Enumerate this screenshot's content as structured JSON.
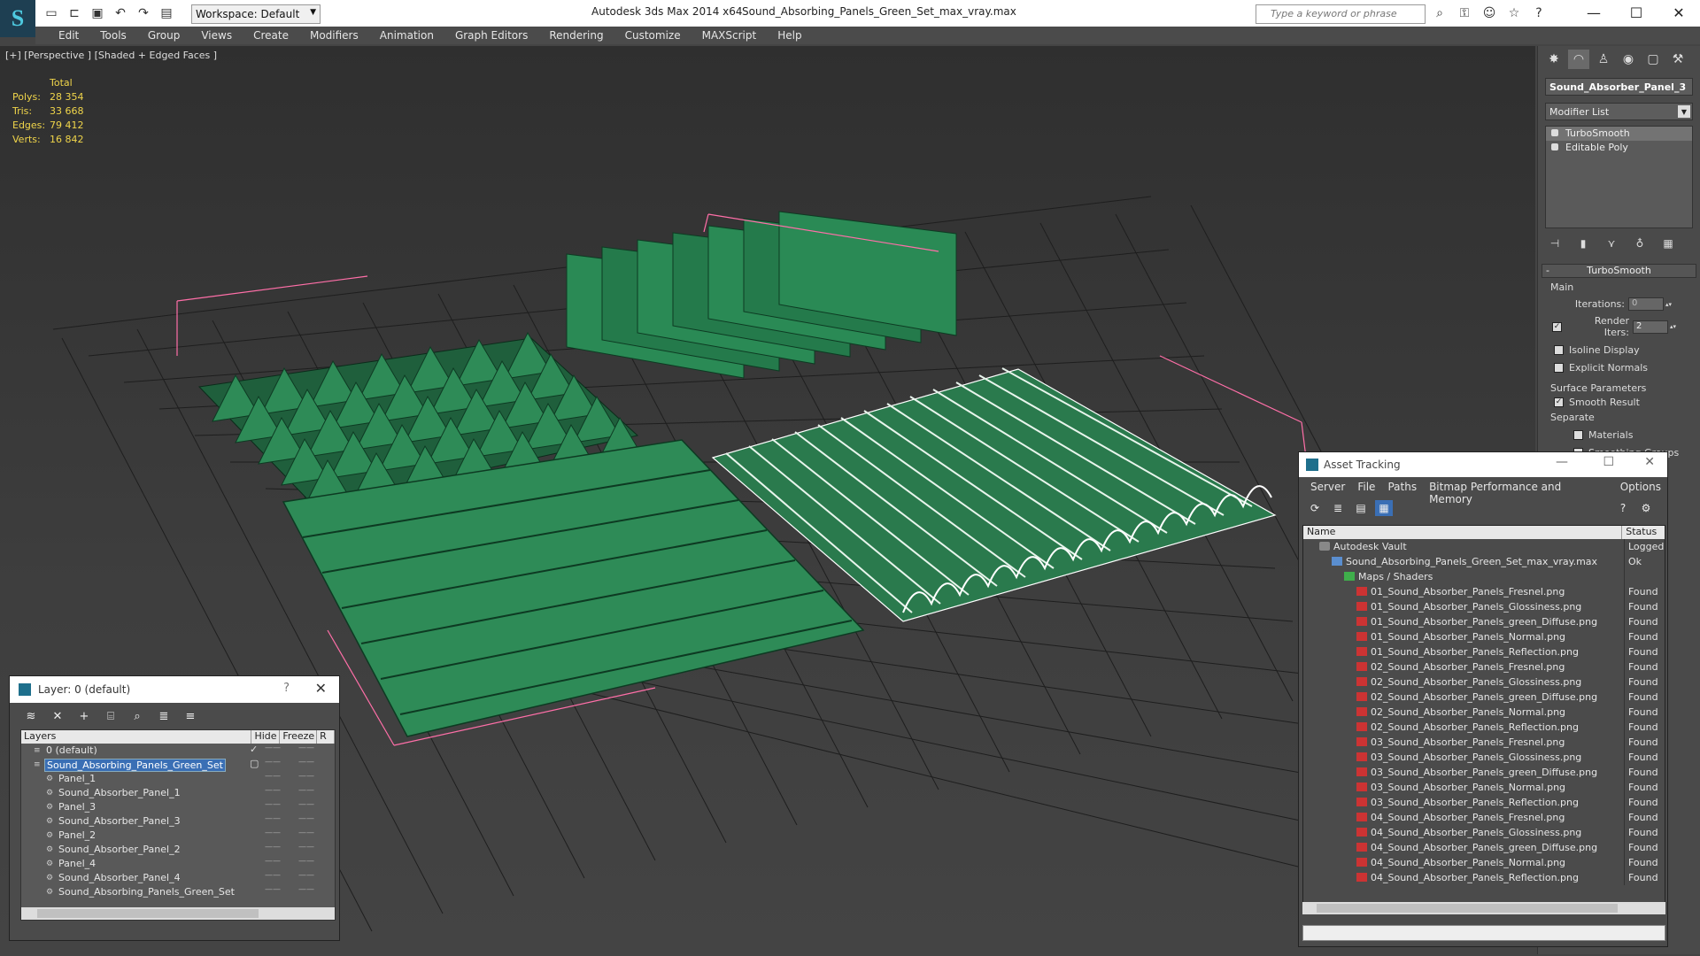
{
  "titlebar": {
    "app_title": "Autodesk 3ds Max  2014 x64",
    "file_title": "Sound_Absorbing_Panels_Green_Set_max_vray.max",
    "workspace_label": "Workspace: Default",
    "search_placeholder": "Type a keyword or phrase"
  },
  "menu": [
    "Edit",
    "Tools",
    "Group",
    "Views",
    "Create",
    "Modifiers",
    "Animation",
    "Graph Editors",
    "Rendering",
    "Customize",
    "MAXScript",
    "Help"
  ],
  "viewport": {
    "label": "[+] [Perspective ] [Shaded + Edged Faces ]",
    "stats": {
      "header": "Total",
      "rows": [
        {
          "k": "Polys:",
          "v": "28 354"
        },
        {
          "k": "Tris:",
          "v": "33 668"
        },
        {
          "k": "Edges:",
          "v": "79 412"
        },
        {
          "k": "Verts:",
          "v": "16 842"
        }
      ]
    }
  },
  "command_panel": {
    "object_name": "Sound_Absorber_Panel_3",
    "modifier_list": "Modifier List",
    "stack": [
      "TurboSmooth",
      "Editable Poly"
    ],
    "rollout_title": "TurboSmooth",
    "main_label": "Main",
    "iterations_label": "Iterations:",
    "iterations_value": "0",
    "render_iters_label": "Render Iters:",
    "render_iters_value": "2",
    "isoline_label": "Isoline Display",
    "explicit_label": "Explicit Normals",
    "surface_label": "Surface Parameters",
    "smooth_label": "Smooth Result",
    "separate_label": "Separate",
    "materials_label": "Materials",
    "smoothing_groups_label": "Smoothing Groups"
  },
  "layer_window": {
    "title": "Layer: 0 (default)",
    "columns": [
      "Layers",
      "Hide",
      "Freeze",
      "R"
    ],
    "rows": [
      {
        "name": "0 (default)",
        "indent": 0,
        "selected": false
      },
      {
        "name": "Sound_Absorbing_Panels_Green_Set",
        "indent": 0,
        "selected": true
      },
      {
        "name": "Panel_1",
        "indent": 1,
        "selected": false
      },
      {
        "name": "Sound_Absorber_Panel_1",
        "indent": 1,
        "selected": false
      },
      {
        "name": "Panel_3",
        "indent": 1,
        "selected": false
      },
      {
        "name": "Sound_Absorber_Panel_3",
        "indent": 1,
        "selected": false
      },
      {
        "name": "Panel_2",
        "indent": 1,
        "selected": false
      },
      {
        "name": "Sound_Absorber_Panel_2",
        "indent": 1,
        "selected": false
      },
      {
        "name": "Panel_4",
        "indent": 1,
        "selected": false
      },
      {
        "name": "Sound_Absorber_Panel_4",
        "indent": 1,
        "selected": false
      },
      {
        "name": "Sound_Absorbing_Panels_Green_Set",
        "indent": 1,
        "selected": false
      }
    ]
  },
  "asset_window": {
    "title": "Asset Tracking",
    "menu": [
      "Server",
      "File",
      "Paths",
      "Bitmap Performance and Memory",
      "Options"
    ],
    "columns": [
      "Name",
      "Status"
    ],
    "rows": [
      {
        "name": "Autodesk Vault",
        "status": "Logged O",
        "indent": 0,
        "icon": "vault"
      },
      {
        "name": "Sound_Absorbing_Panels_Green_Set_max_vray.max",
        "status": "Ok",
        "indent": 1,
        "icon": "mx"
      },
      {
        "name": "Maps / Shaders",
        "status": "",
        "indent": 2,
        "icon": "dir"
      },
      {
        "name": "01_Sound_Absorber_Panels_Fresnel.png",
        "status": "Found",
        "indent": 3,
        "icon": "png"
      },
      {
        "name": "01_Sound_Absorber_Panels_Glossiness.png",
        "status": "Found",
        "indent": 3,
        "icon": "png"
      },
      {
        "name": "01_Sound_Absorber_Panels_green_Diffuse.png",
        "status": "Found",
        "indent": 3,
        "icon": "png"
      },
      {
        "name": "01_Sound_Absorber_Panels_Normal.png",
        "status": "Found",
        "indent": 3,
        "icon": "png"
      },
      {
        "name": "01_Sound_Absorber_Panels_Reflection.png",
        "status": "Found",
        "indent": 3,
        "icon": "png"
      },
      {
        "name": "02_Sound_Absorber_Panels_Fresnel.png",
        "status": "Found",
        "indent": 3,
        "icon": "png"
      },
      {
        "name": "02_Sound_Absorber_Panels_Glossiness.png",
        "status": "Found",
        "indent": 3,
        "icon": "png"
      },
      {
        "name": "02_Sound_Absorber_Panels_green_Diffuse.png",
        "status": "Found",
        "indent": 3,
        "icon": "png"
      },
      {
        "name": "02_Sound_Absorber_Panels_Normal.png",
        "status": "Found",
        "indent": 3,
        "icon": "png"
      },
      {
        "name": "02_Sound_Absorber_Panels_Reflection.png",
        "status": "Found",
        "indent": 3,
        "icon": "png"
      },
      {
        "name": "03_Sound_Absorber_Panels_Fresnel.png",
        "status": "Found",
        "indent": 3,
        "icon": "png"
      },
      {
        "name": "03_Sound_Absorber_Panels_Glossiness.png",
        "status": "Found",
        "indent": 3,
        "icon": "png"
      },
      {
        "name": "03_Sound_Absorber_Panels_green_Diffuse.png",
        "status": "Found",
        "indent": 3,
        "icon": "png"
      },
      {
        "name": "03_Sound_Absorber_Panels_Normal.png",
        "status": "Found",
        "indent": 3,
        "icon": "png"
      },
      {
        "name": "03_Sound_Absorber_Panels_Reflection.png",
        "status": "Found",
        "indent": 3,
        "icon": "png"
      },
      {
        "name": "04_Sound_Absorber_Panels_Fresnel.png",
        "status": "Found",
        "indent": 3,
        "icon": "png"
      },
      {
        "name": "04_Sound_Absorber_Panels_Glossiness.png",
        "status": "Found",
        "indent": 3,
        "icon": "png"
      },
      {
        "name": "04_Sound_Absorber_Panels_green_Diffuse.png",
        "status": "Found",
        "indent": 3,
        "icon": "png"
      },
      {
        "name": "04_Sound_Absorber_Panels_Normal.png",
        "status": "Found",
        "indent": 3,
        "icon": "png"
      },
      {
        "name": "04_Sound_Absorber_Panels_Reflection.png",
        "status": "Found",
        "indent": 3,
        "icon": "png"
      }
    ]
  },
  "colors": {
    "panel_green": "#2e8b57",
    "selection_pink": "#ff6fa8",
    "stats_yellow": "#f0d54a",
    "selection_blue": "#3a6fb5"
  }
}
